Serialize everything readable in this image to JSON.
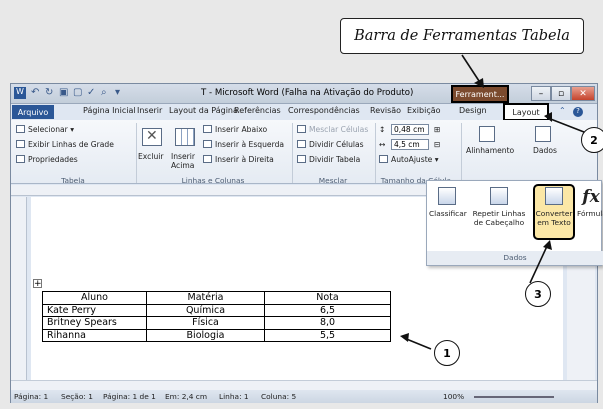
{
  "callout": "Barra de Ferramentas Tabela",
  "window": {
    "title": "T - Microsoft Word (Falha na Ativação do Produto)",
    "context_tab": "Ferrament...",
    "min": "–",
    "max": "▫",
    "close": "✕"
  },
  "tabs": [
    "Arquivo",
    "Página Inicial",
    "Inserir",
    "Layout da Página",
    "Referências",
    "Correspondências",
    "Revisão",
    "Exibição",
    "Design",
    "Layout"
  ],
  "ribbon": {
    "selecionar": "Selecionar ▾",
    "exibir_linhas": "Exibir Linhas de Grade",
    "propriedades": "Propriedades",
    "tabela_grp": "Tabela",
    "excluir": "Excluir",
    "inserir_acima": "Inserir Acima",
    "inserir_abaixo": "Inserir Abaixo",
    "inserir_esquerda": "Inserir à Esquerda",
    "inserir_direita": "Inserir à Direita",
    "linhas_grp": "Linhas e Colunas",
    "mesclar_celulas": "Mesclar Células",
    "dividir_celulas": "Dividir Células",
    "dividir_tabela": "Dividir Tabela",
    "mesclar_grp": "Mesclar",
    "height": "0,48 cm",
    "width": "4,5 cm",
    "autoajuste": "AutoAjuste ▾",
    "tamanho_grp": "Tamanho da Célula",
    "alinhamento": "Alinhamento",
    "dados": "Dados"
  },
  "popup": {
    "classificar": "Classificar",
    "repetir": "Repetir Linhas de Cabeçalho",
    "converter": "Converter em Texto",
    "formula": "Fórmula",
    "group": "Dados",
    "fx": "fx"
  },
  "table": {
    "headers": [
      "Aluno",
      "Matéria",
      "Nota"
    ],
    "rows": [
      [
        "Kate Perry",
        "Química",
        "6,5"
      ],
      [
        "Britney Spears",
        "Física",
        "8,0"
      ],
      [
        "Rihanna",
        "Biologia",
        "5,5"
      ]
    ]
  },
  "status": {
    "pagina": "Página: 1",
    "secao": "Seção: 1",
    "pagina_de": "Página: 1 de 1",
    "em": "Em: 2,4 cm",
    "linha": "Linha: 1",
    "coluna": "Coluna: 5",
    "zoom": "100%"
  },
  "callouts_nums": [
    "1",
    "2",
    "3"
  ]
}
